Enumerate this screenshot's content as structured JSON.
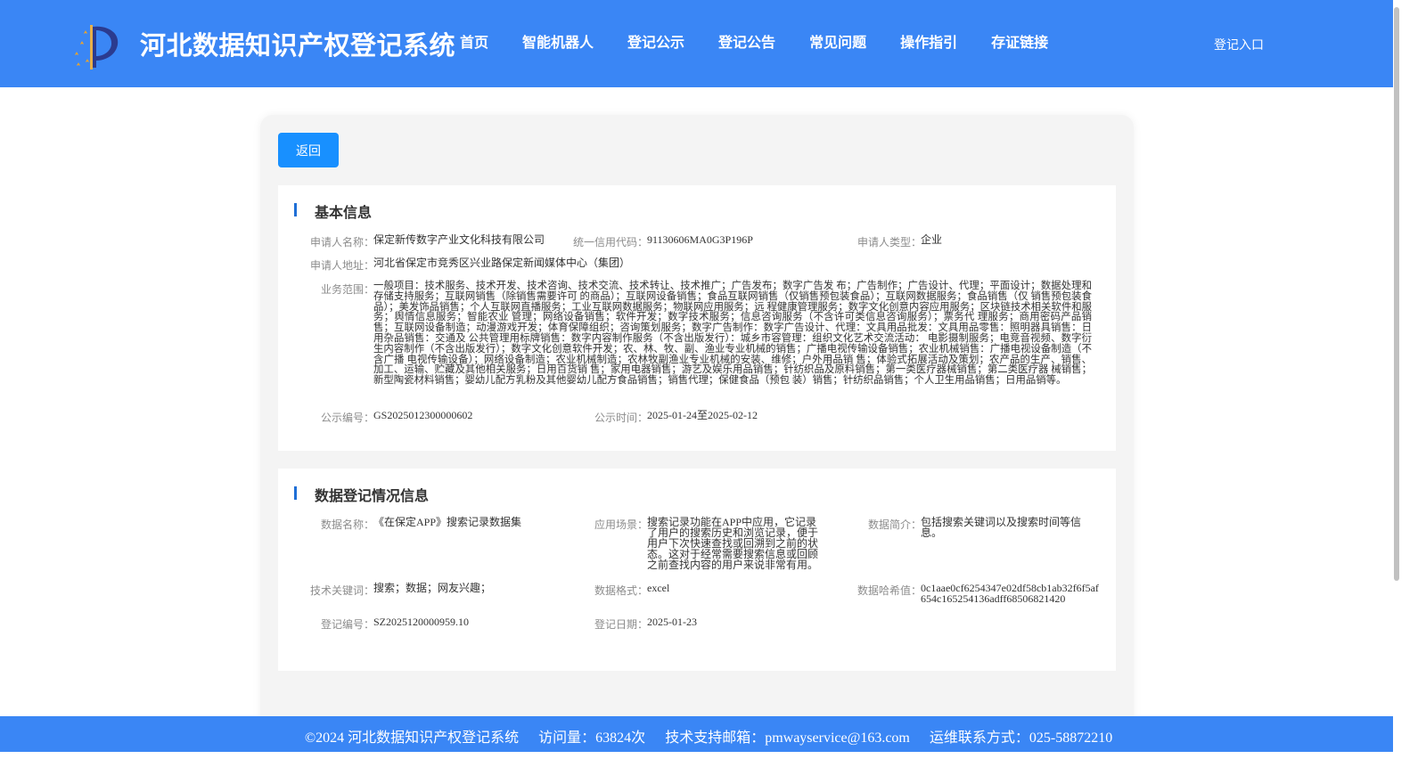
{
  "header": {
    "site_title": "河北数据知识产权登记系统",
    "nav": [
      "首页",
      "智能机器人",
      "登记公示",
      "登记公告",
      "常见问题",
      "操作指引",
      "存证链接"
    ],
    "login_label": "登记入口",
    "colors": {
      "header_bg": "#3a86f5",
      "accent": "#1890ff"
    }
  },
  "actions": {
    "back_label": "返回"
  },
  "basic_info": {
    "title": "基本信息",
    "applicant_name_label": "申请人名称：",
    "applicant_name": "保定新传数字产业文化科技有限公司",
    "credit_code_label": "统一信用代码：",
    "credit_code": "91130606MA0G3P196P",
    "applicant_type_label": "申请人类型：",
    "applicant_type": "企业",
    "address_label": "申请人地址：",
    "address": "河北省保定市竞秀区兴业路保定新闻媒体中心（集团）",
    "scope_label": "业务范围：",
    "scope": "一般项目：技术服务、技术开发、技术咨询、技术交流、技术转让、技术推广；广告发布；数字广告发 布；广告制作；广告设计、代理；平面设计；数据处理和存储支持服务；互联网销售（除销售需要许可 的商品）；互联网设备销售；食品互联网销售（仅销售预包装食品）；互联网数据服务；食品销售（仅 销售预包装食品）；美发饰品销售；个人互联网直播服务；工业互联网数据服务；物联网应用服务；远 程健康管理服务；数字文化创意内容应用服务；区块链技术相关软件和服务；舆情信息服务；智能农业 管理；网络设备销售；软件开发；数字技术服务；信息咨询服务（不含许可类信息咨询服务）；票务代 理服务；商用密码产品销售；互联网设备制造；动漫游戏开发；体育保障组织；咨询策划服务；数字广告制作：数字广告设计、代理：文具用品批发：文具用品零售：照明器具销售：日用杂品销售：交通及 公共管理用标牌销售：数字内容制作服务（不含出版发行）：城乡市容管理：组织文化艺术交流活动： 电影摄制服务；电竞音视频、数字衍生内容制作（不含出版发行）；数字文化创意软件开发；农、林、牧、副、渔业专业机械的销售；广播电视传输设备销售；农业机械销售：广播电视设备制造（不含广播 电视传输设备）；网络设备制造；农业机械制造；农林牧副渔业专业机械的安装、维修；户外用品销 售；体验式拓展活动及策划；农产品的生产、销售、加工、运输、贮藏及其他相关服务；日用百货销 售；家用电器销售；游艺及娱乐用品销售；针纺织品及原料销售；第一类医疗器械销售；第二类医疗器 械销售；新型陶瓷材料销售；婴幼儿配方乳粉及其他婴幼儿配方食品销售；销售代理；保健食品（预包 装）销售；针纺织品销售；个人卫生用品销售；日用品销等。",
    "notice_no_label": "公示编号：",
    "notice_no": "GS2025012300000602",
    "notice_time_label": "公示时间：",
    "notice_time": "2025-01-24至2025-02-12"
  },
  "data_info": {
    "title": "数据登记情况信息",
    "data_name_label": "数据名称：",
    "data_name": "《在保定APP》搜索记录数据集",
    "scenario_label": "应用场景：",
    "scenario": "搜索记录功能在APP中应用，它记录了用户的搜索历史和浏览记录，便于用户下次快速查找或回溯到之前的状态。这对于经常需要搜索信息或回顾之前查找内容的用户来说非常有用。",
    "summary_label": "数据简介：",
    "summary": "包括搜索关键词以及搜索时间等信息。",
    "keywords_label": "技术关键词：",
    "keywords": "搜索；数据；网友兴趣；",
    "format_label": "数据格式：",
    "format": "excel",
    "hash_label": "数据哈希值：",
    "hash": "0c1aae0cf6254347e02df58cb1ab32f6f5af654c165254136adff68506821420",
    "reg_no_label": "登记编号：",
    "reg_no": "SZ2025120000959.10",
    "reg_date_label": "登记日期：",
    "reg_date": "2025-01-23"
  },
  "footer": {
    "copyright": "©2024 河北数据知识产权登记系统",
    "visits": "访问量：63824次",
    "support_email": "技术支持邮箱：pmwayservice@163.com",
    "ops_contact": "运维联系方式：025-58872210"
  }
}
